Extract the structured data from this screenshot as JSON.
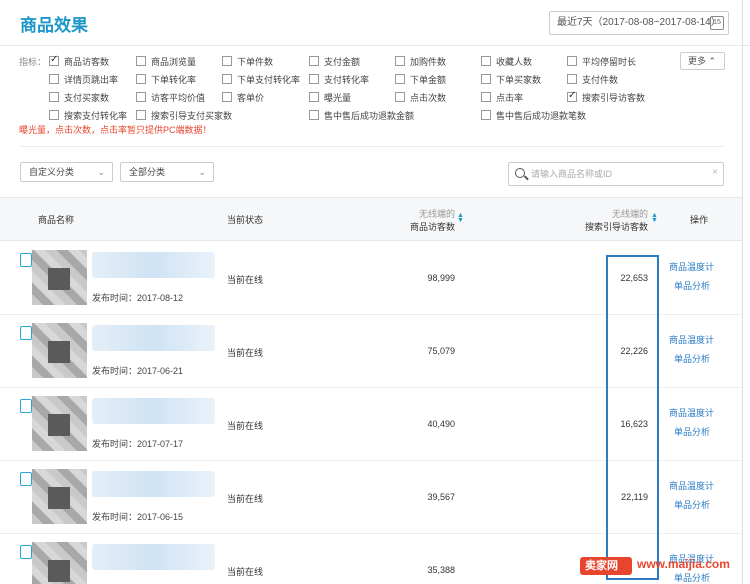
{
  "header": {
    "title": "商品效果",
    "date_range": "最近7天（2017-08-08~2017-08-14）",
    "calendar_day": "15"
  },
  "metrics": {
    "label": "指标：",
    "more_label": "更多",
    "items": [
      {
        "label": "商品访客数",
        "checked": true
      },
      {
        "label": "商品浏览量",
        "checked": false
      },
      {
        "label": "下单件数",
        "checked": false
      },
      {
        "label": "支付金额",
        "checked": false
      },
      {
        "label": "加购件数",
        "checked": false
      },
      {
        "label": "收藏人数",
        "checked": false
      },
      {
        "label": "平均停留时长",
        "checked": false
      },
      {
        "label": "详情页跳出率",
        "checked": false
      },
      {
        "label": "下单转化率",
        "checked": false
      },
      {
        "label": "下单支付转化率",
        "checked": false
      },
      {
        "label": "支付转化率",
        "checked": false
      },
      {
        "label": "下单金额",
        "checked": false
      },
      {
        "label": "下单买家数",
        "checked": false
      },
      {
        "label": "支付件数",
        "checked": false
      },
      {
        "label": "支付买家数",
        "checked": false
      },
      {
        "label": "访客平均价值",
        "checked": false
      },
      {
        "label": "客单价",
        "checked": false
      },
      {
        "label": "曝光量",
        "checked": false
      },
      {
        "label": "点击次数",
        "checked": false
      },
      {
        "label": "点击率",
        "checked": false
      },
      {
        "label": "搜索引导访客数",
        "checked": true
      },
      {
        "label": "搜索支付转化率",
        "checked": false
      },
      {
        "label": "搜索引导支付买家数",
        "checked": false
      },
      {
        "label": "售中售后成功退款金额",
        "checked": false
      },
      {
        "label": "售中售后成功退款笔数",
        "checked": false
      }
    ],
    "warning": "曝光量，点击次数，点击率暂只提供PC端数据！"
  },
  "filters": {
    "custom_category": "自定义分类",
    "all_category": "全部分类",
    "search_placeholder": "请输入商品名称或ID"
  },
  "table": {
    "headers": {
      "name": "商品名称",
      "status": "当前状态",
      "visitors_sub": "无线端的",
      "visitors": "商品访客数",
      "search_sub": "无线端的",
      "search": "搜索引导访客数",
      "action": "操作"
    },
    "rows": [
      {
        "publish": "发布时间：2017-08-12",
        "status": "当前在线",
        "visitors": "98,999",
        "search_visitors": "22,653",
        "link1": "商品温度计",
        "link2": "单品分析"
      },
      {
        "publish": "发布时间：2017-06-21",
        "status": "当前在线",
        "visitors": "75,079",
        "search_visitors": "22,226",
        "link1": "商品温度计",
        "link2": "单品分析"
      },
      {
        "publish": "发布时间：2017-07-17",
        "status": "当前在线",
        "visitors": "40,490",
        "search_visitors": "16,623",
        "link1": "商品温度计",
        "link2": "单品分析"
      },
      {
        "publish": "发布时间：2017-06-15",
        "status": "当前在线",
        "visitors": "39,567",
        "search_visitors": "22,119",
        "link1": "商品温度计",
        "link2": "单品分析"
      },
      {
        "publish": "",
        "status": "当前在线",
        "visitors": "35,388",
        "search_visitors": "",
        "link1": "商品温度计",
        "link2": "单品分析"
      }
    ]
  },
  "watermark": {
    "badge": "卖家网",
    "url": "www.maijia.com"
  },
  "colors": {
    "accent": "#1c97c8",
    "link": "#2a7bc6",
    "warning": "#e8452e"
  }
}
